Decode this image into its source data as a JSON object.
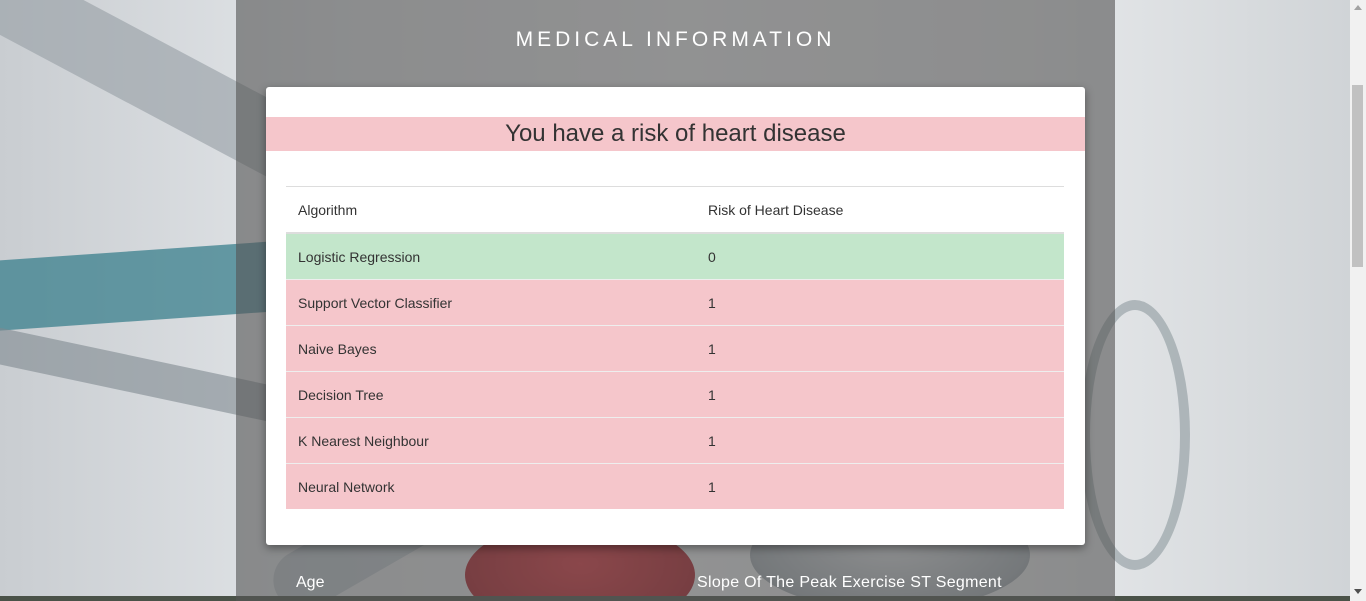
{
  "page": {
    "title": "MEDICAL INFORMATION"
  },
  "modal": {
    "alert": "You have a risk of heart disease",
    "table": {
      "headers": [
        "Algorithm",
        "Risk of Heart Disease"
      ],
      "rows": [
        {
          "algorithm": "Logistic Regression",
          "risk": "0",
          "status": "success"
        },
        {
          "algorithm": "Support Vector Classifier",
          "risk": "1",
          "status": "danger"
        },
        {
          "algorithm": "Naive Bayes",
          "risk": "1",
          "status": "danger"
        },
        {
          "algorithm": "Decision Tree",
          "risk": "1",
          "status": "danger"
        },
        {
          "algorithm": "K Nearest Neighbour",
          "risk": "1",
          "status": "danger"
        },
        {
          "algorithm": "Neural Network",
          "risk": "1",
          "status": "danger"
        }
      ]
    }
  },
  "form": {
    "age_label": "Age",
    "slope_label": "Slope Of The Peak Exercise ST Segment"
  },
  "colors": {
    "success_row": "#c3e6cb",
    "danger_row": "#f5c6cb",
    "overlay": "#555555"
  }
}
